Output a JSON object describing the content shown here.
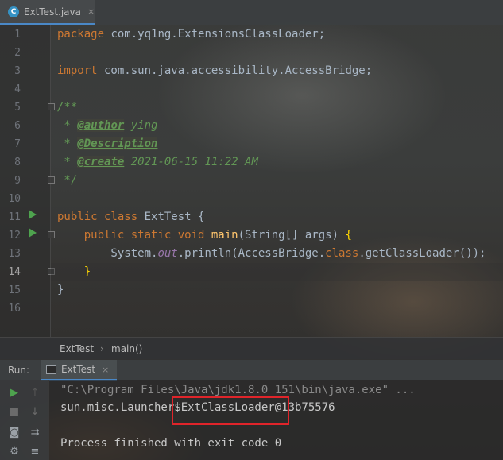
{
  "tab": {
    "label": "ExtTest.java",
    "icon": "java-class-icon",
    "close": "×",
    "icon_letter": "C"
  },
  "line_numbers": [
    "1",
    "2",
    "3",
    "4",
    "5",
    "6",
    "7",
    "8",
    "9",
    "10",
    "11",
    "12",
    "13",
    "14",
    "15",
    "16"
  ],
  "code": {
    "l1_kw": "package",
    "l1_rest": " com.yq1ng.ExtensionsClassLoader;",
    "l3_kw": "import",
    "l3_rest": " com.sun.java.accessibility.AccessBridge;",
    "l5": "/**",
    "l6_pre": " * ",
    "l6_tag": "@author",
    "l6_val": " ying",
    "l7_pre": " * ",
    "l7_tag": "@Description",
    "l8_pre": " * ",
    "l8_tag": "@create",
    "l8_val": " 2021-06-15 11:22 AM",
    "l9": " */",
    "l11_kw": "public class",
    "l11_rest": " ExtTest {",
    "l12_kw": "    public static void",
    "l12_meth": " main",
    "l12_rest": "(String[] args) ",
    "l12_brace": "{",
    "l13_a": "        System.",
    "l13_fld": "out",
    "l13_b": ".println(AccessBridge.",
    "l13_kw": "class",
    "l13_c": ".getClassLoader());",
    "l14_brace": "    }",
    "l15": "}"
  },
  "breadcrumb": {
    "class": "ExtTest",
    "method": "main()"
  },
  "run": {
    "title": "Run:",
    "tab_label": "ExtTest",
    "tab_close": "×",
    "cmd_line": "\"C:\\Program Files\\Java\\jdk1.8.0_151\\bin\\java.exe\" ...",
    "output_line": "sun.misc.Launcher$ExtClassLoader@13b75576",
    "exit_line": "Process finished with exit code 0"
  },
  "colors": {
    "keyword": "#cc7832",
    "comment": "#629755",
    "method": "#ffc66d",
    "field": "#9876aa",
    "highlight_box": "#e0242a",
    "run_green": "#4ea34e"
  }
}
